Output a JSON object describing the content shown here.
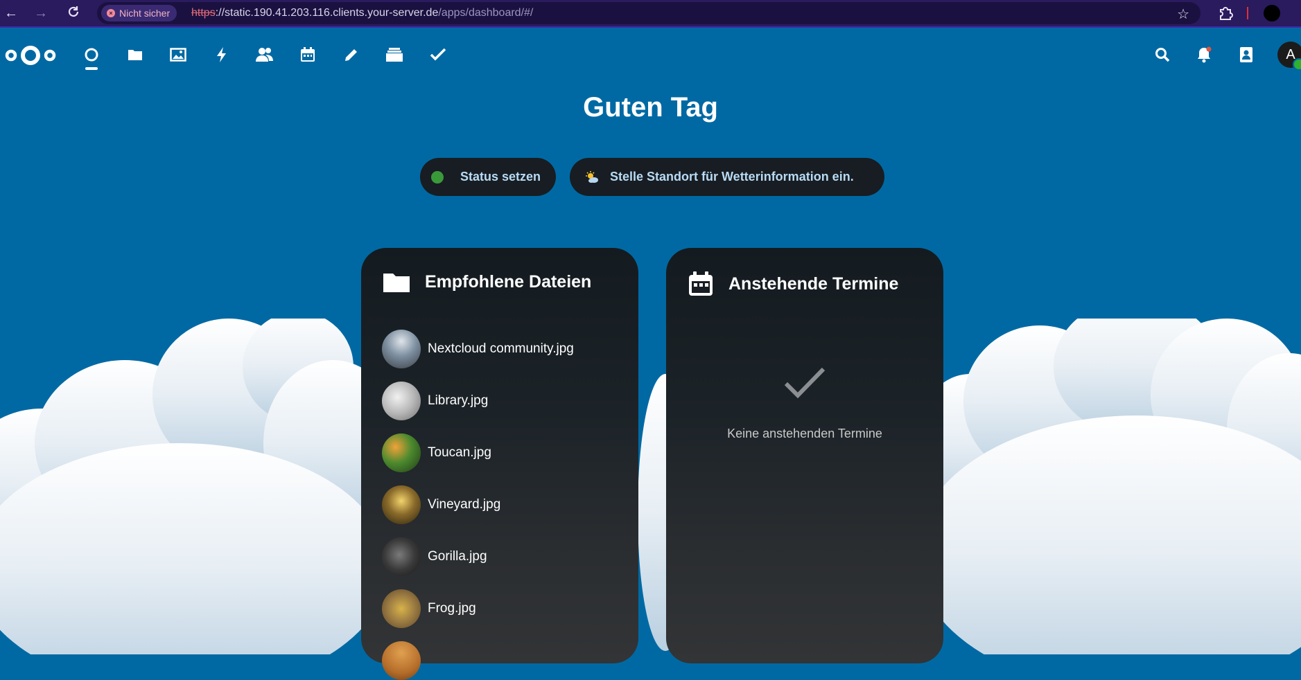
{
  "browser": {
    "security_label": "Nicht sicher",
    "url_scheme": "https",
    "url_host": "://static.190.41.203.116.clients.your-server.de",
    "url_path": "/apps/dashboard/#/",
    "icons": [
      "back-arrow-icon",
      "forward-arrow-icon",
      "reload-icon",
      "star-icon",
      "extensions-icon",
      "profile-icon"
    ]
  },
  "header": {
    "apps": [
      "dashboard",
      "files",
      "photos",
      "activity",
      "contacts",
      "calendar",
      "notes",
      "deck",
      "tasks"
    ],
    "right_icons": [
      "search",
      "notifications",
      "contacts-menu"
    ],
    "avatar_initial": "A"
  },
  "main": {
    "greeting": "Guten Tag",
    "status_button": "Status setzen",
    "weather_button": "Stelle Standort für Wetterinformation ein.",
    "files_widget": {
      "title": "Empfohlene Dateien",
      "items": [
        {
          "name": "Nextcloud community.jpg"
        },
        {
          "name": "Library.jpg"
        },
        {
          "name": "Toucan.jpg"
        },
        {
          "name": "Vineyard.jpg"
        },
        {
          "name": "Gorilla.jpg"
        },
        {
          "name": "Frog.jpg"
        }
      ]
    },
    "events_widget": {
      "title": "Anstehende Termine",
      "empty_text": "Keine anstehenden Termine"
    }
  },
  "colors": {
    "header_bg": "#0069a3",
    "panel_bg": "#1b2227",
    "status_online": "#2fb130"
  }
}
